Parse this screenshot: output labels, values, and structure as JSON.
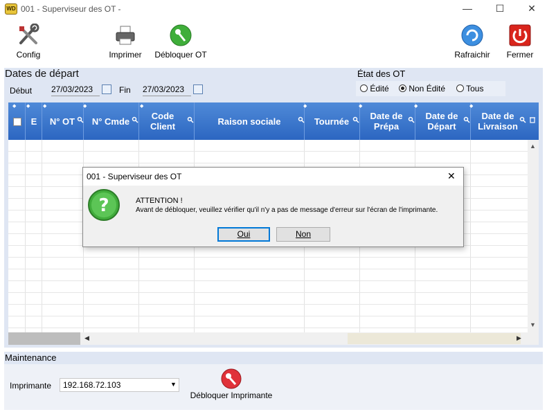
{
  "window": {
    "title": "001 - Superviseur des OT -",
    "app_icon_label": "WD",
    "minimize": "—",
    "maximize": "☐",
    "close": "✕"
  },
  "toolbar": {
    "config": "Config",
    "imprimer": "Imprimer",
    "debloquer_ot": "Débloquer OT",
    "rafraichir": "Rafraichir",
    "fermer": "Fermer"
  },
  "dates": {
    "section_title": "Dates de départ",
    "debut_label": "Début",
    "debut_value": "27/03/2023",
    "fin_label": "Fin",
    "fin_value": "27/03/2023"
  },
  "etat": {
    "section_title": "État des OT",
    "options": [
      "Édité",
      "Non Édité",
      "Tous"
    ],
    "selected": "Non Édité"
  },
  "grid": {
    "columns": [
      {
        "label": "E"
      },
      {
        "label": "N° OT"
      },
      {
        "label": "N° Cmde"
      },
      {
        "label": "Code Client"
      },
      {
        "label": "Raison sociale"
      },
      {
        "label": "Tournée"
      },
      {
        "label": "Date de Prépa"
      },
      {
        "label": "Date de Départ"
      },
      {
        "label": "Date de Livraison"
      }
    ],
    "rows": []
  },
  "dialog": {
    "title": "001 - Superviseur des OT",
    "heading": "ATTENTION !",
    "message": "Avant de débloquer, veuillez vérifier qu'il n'y a pas de message d'erreur sur l'écran de l'imprimante.",
    "yes_label": "Oui",
    "no_label": "Non",
    "close": "✕"
  },
  "maintenance": {
    "section_title": "Maintenance",
    "imprimante_label": "Imprimante",
    "imprimante_value": "192.168.72.103",
    "debloquer_imprimante": "Débloquer Imprimante"
  },
  "colors": {
    "header_blue": "#2c66c1",
    "band": "#dfe6f3",
    "fermer_red": "#d9251c",
    "debloquer_green": "#3fae3a"
  }
}
